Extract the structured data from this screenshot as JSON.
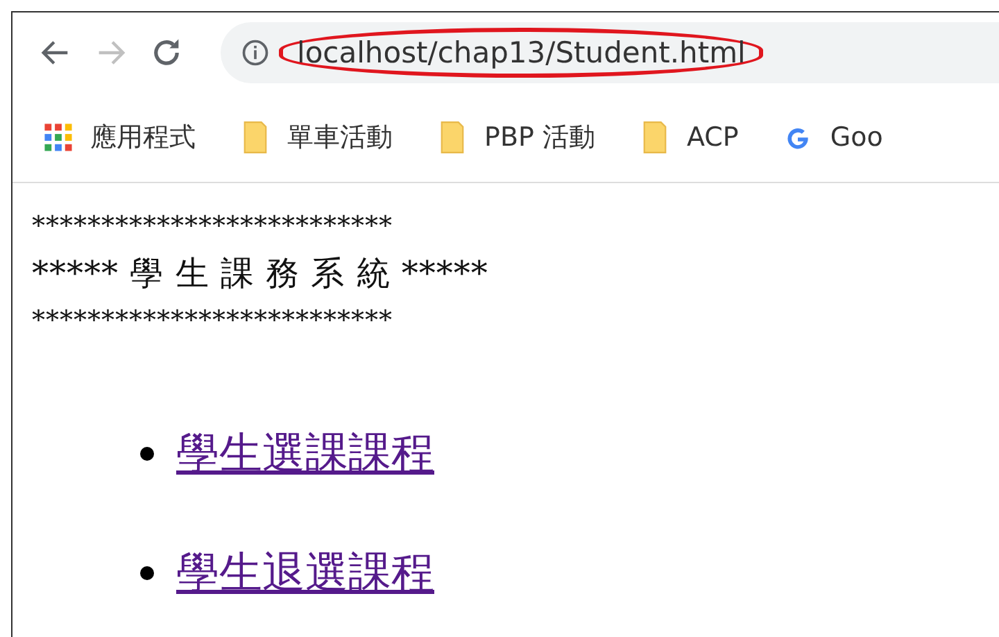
{
  "address_bar": {
    "url": "localhost/chap13/Student.html",
    "highlighted": true
  },
  "bookmarks": [
    {
      "kind": "apps",
      "label": "應用程式"
    },
    {
      "kind": "folder",
      "label": "單車活動"
    },
    {
      "kind": "folder",
      "label": "PBP 活動"
    },
    {
      "kind": "folder",
      "label": "ACP"
    },
    {
      "kind": "google",
      "label": "Goo"
    }
  ],
  "banner": [
    "**************************",
    "***** 學 生 課 務 系 統 *****",
    "**************************"
  ],
  "links": [
    {
      "label": "學生選課課程",
      "visited": true
    },
    {
      "label": "學生退選課程",
      "visited": true
    }
  ]
}
